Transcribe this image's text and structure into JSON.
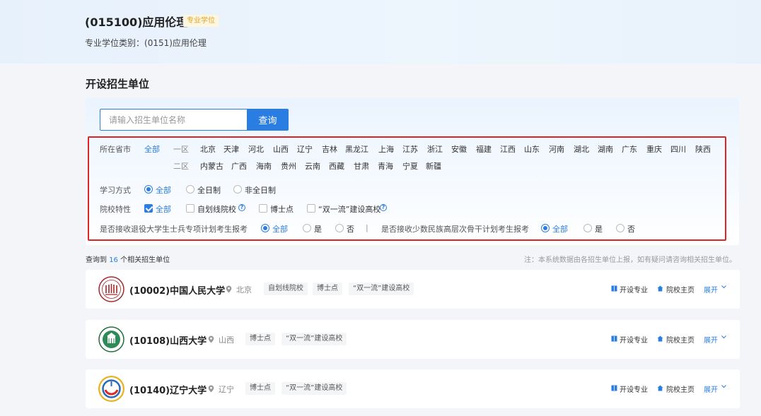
{
  "header": {
    "title": "(015100)应用伦理",
    "badge": "专业学位",
    "category_label": "专业学位类别：",
    "category_value": "(0151)应用伦理"
  },
  "section_title": "开设招生单位",
  "search": {
    "placeholder": "请输入招生单位名称",
    "button": "查询"
  },
  "filters": {
    "province_label": "所在省市",
    "province_all": "全部",
    "region1_label": "一区",
    "region1": [
      "北京",
      "天津",
      "河北",
      "山西",
      "辽宁",
      "吉林",
      "黑龙江",
      "上海",
      "江苏",
      "浙江",
      "安徽",
      "福建",
      "江西",
      "山东",
      "河南",
      "湖北",
      "湖南",
      "广东",
      "重庆",
      "四川",
      "陕西"
    ],
    "region2_label": "二区",
    "region2": [
      "内蒙古",
      "广西",
      "海南",
      "贵州",
      "云南",
      "西藏",
      "甘肃",
      "青海",
      "宁夏",
      "新疆"
    ],
    "study_label": "学习方式",
    "study_options": [
      "全部",
      "全日制",
      "非全日制"
    ],
    "school_label": "院校特性",
    "school_options": [
      "全部",
      "自划线院校",
      "博士点",
      "“双一流”建设高校"
    ],
    "veteran_label": "是否接收退役大学生士兵专项计划考生报考",
    "veteran_options": [
      "全部",
      "是",
      "否"
    ],
    "separator": "|",
    "minority_label": "是否接收少数民族高层次骨干计划考生报考",
    "minority_options": [
      "全部",
      "是",
      "否"
    ]
  },
  "results": {
    "prefix": "查询到",
    "count": "16",
    "suffix": "个相关招生单位",
    "note": "注：本系统数据由各招生单位上报，如有疑问请咨询相关招生单位。"
  },
  "universities": [
    {
      "name": "(10002)中国人民大学",
      "location": "北京",
      "tags": [
        "自划线院校",
        "博士点",
        "“双一流”建设高校"
      ]
    },
    {
      "name": "(10108)山西大学",
      "location": "山西",
      "tags": [
        "博士点",
        "“双一流”建设高校"
      ]
    },
    {
      "name": "(10140)辽宁大学",
      "location": "辽宁",
      "tags": [
        "博士点",
        "“双一流”建设高校"
      ]
    }
  ],
  "actions": {
    "majors": "开设专业",
    "homepage": "院校主页",
    "expand": "展开"
  },
  "colors": {
    "accent": "#2a7de1",
    "highlight_frame": "#e02424",
    "badge_text": "#e0a32a"
  }
}
